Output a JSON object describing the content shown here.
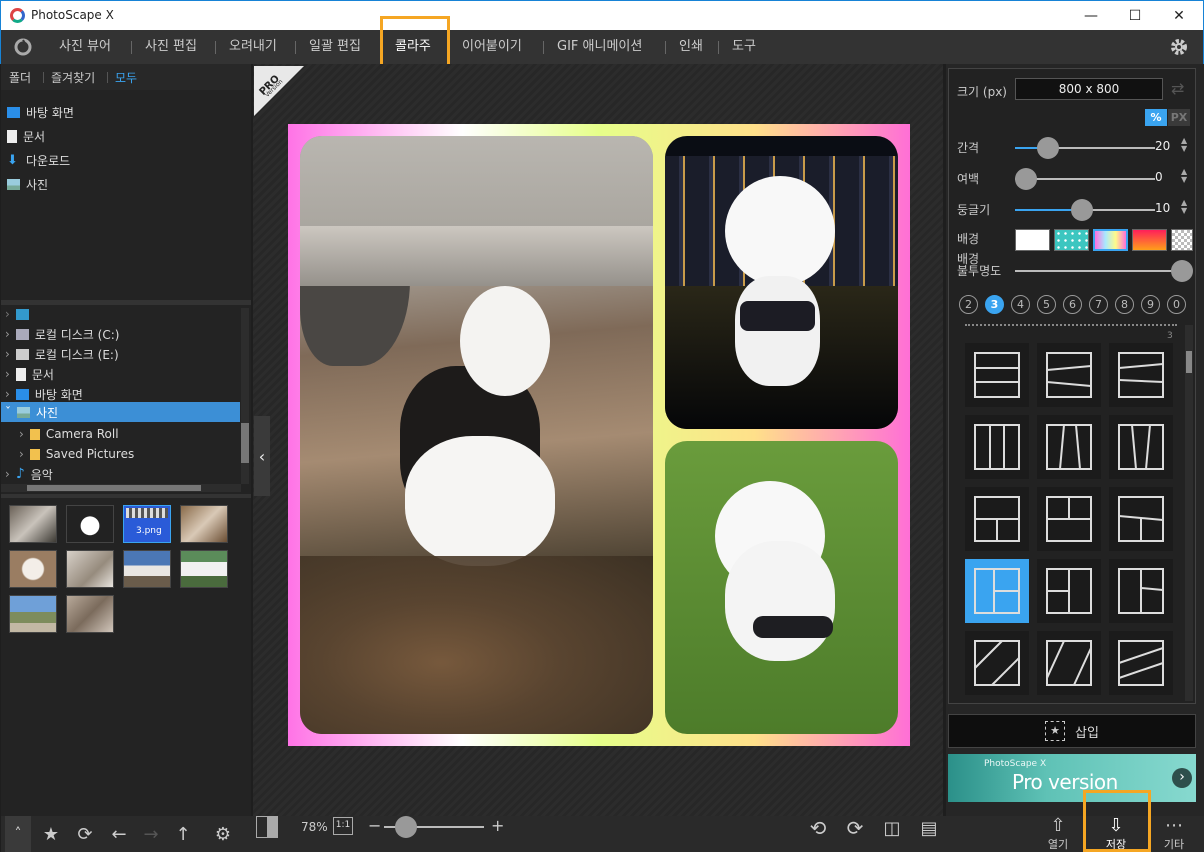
{
  "window": {
    "title": "PhotoScape X"
  },
  "menu": {
    "items": [
      "사진 뷰어",
      "사진 편집",
      "오려내기",
      "일괄 편집",
      "콜라주",
      "이어붙이기",
      "GIF 애니메이션",
      "인쇄",
      "도구"
    ],
    "active": "콜라주"
  },
  "left": {
    "tabs": [
      "폴더",
      "즐겨찾기",
      "모두"
    ],
    "quick_access": [
      "바탕 화면",
      "문서",
      "다운로드",
      "사진"
    ],
    "tree": [
      "로컬 디스크 (C:)",
      "로컬 디스크 (E:)",
      "문서",
      "바탕 화면",
      "사진",
      "Camera Roll",
      "Saved Pictures",
      "음악"
    ],
    "selected_tree": "사진",
    "thumb_label": "3.png"
  },
  "badge": {
    "pro": "PRO",
    "version": "Version"
  },
  "right": {
    "size_label": "크기 (px)",
    "size_value": "800 x 800",
    "unit_percent": "%",
    "unit_px": "PX",
    "spacing_label": "간격",
    "spacing_value": "20",
    "margin_label": "여백",
    "margin_value": "0",
    "round_label": "둥글기",
    "round_value": "10",
    "background_label": "배경",
    "opacity_label_1": "배경",
    "opacity_label_2": "불투명도",
    "numbers": [
      "2",
      "3",
      "4",
      "5",
      "6",
      "7",
      "8",
      "9",
      "0"
    ],
    "active_number": "3",
    "count_small": "3",
    "insert_label": "삽입",
    "promo_small": "PhotoScape X",
    "promo_big": "Pro version"
  },
  "bottom": {
    "zoom": "78%",
    "one_to_one": "1:1",
    "open_label": "열기",
    "save_label": "저장",
    "more_label": "기타"
  },
  "settings": {
    "spacing": 20,
    "margin": 0,
    "roundness": 10,
    "zoom_percent": 78,
    "opacity_percent": 100
  }
}
